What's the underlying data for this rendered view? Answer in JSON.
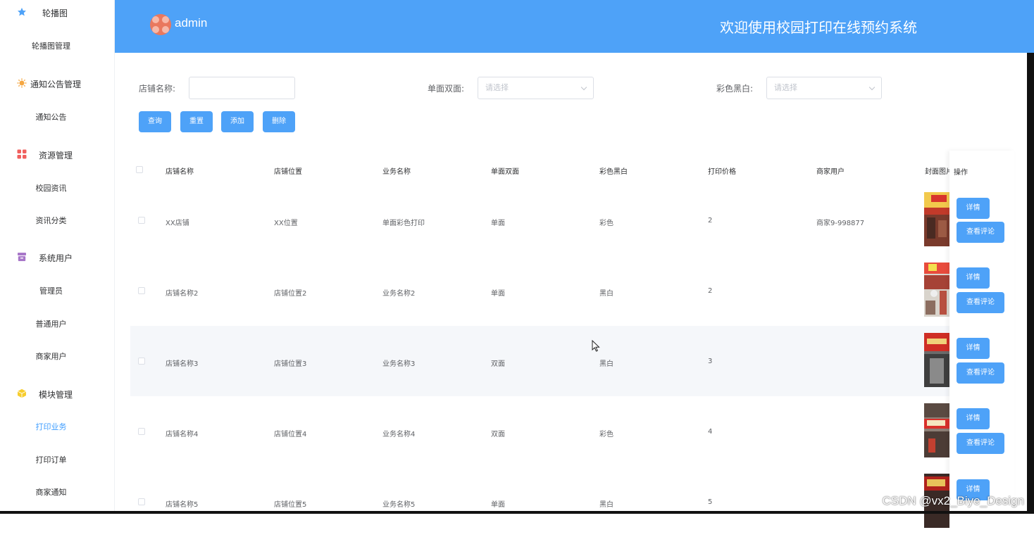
{
  "header": {
    "admin_name": "admin",
    "welcome": "欢迎使用校园打印在线预约系统"
  },
  "sidebar": {
    "groups": [
      {
        "label": "轮播图",
        "icon": "star-icon",
        "items": [
          "轮播图管理"
        ]
      },
      {
        "label": "通知公告管理",
        "icon": "sun-icon",
        "items": [
          "通知公告"
        ]
      },
      {
        "label": "资源管理",
        "icon": "grid-icon",
        "items": [
          "校园资讯",
          "资讯分类"
        ]
      },
      {
        "label": "系统用户",
        "icon": "archive-icon",
        "items": [
          "管理员",
          "普通用户",
          "商家用户"
        ]
      },
      {
        "label": "模块管理",
        "icon": "cube-icon",
        "items": [
          "打印业务",
          "打印订单",
          "商家通知"
        ]
      }
    ],
    "active_item": "打印业务"
  },
  "filters": {
    "shop_name_label": "店铺名称:",
    "shop_name_value": "",
    "sides_label": "单面双面:",
    "sides_placeholder": "请选择",
    "color_label": "彩色黑白:",
    "color_placeholder": "请选择"
  },
  "actions": {
    "query": "查询",
    "reset": "重置",
    "add": "添加",
    "delete": "删除"
  },
  "table": {
    "headers": [
      "店铺名称",
      "店铺位置",
      "业务名称",
      "单面双面",
      "彩色黑白",
      "打印价格",
      "商家用户",
      "封面图片",
      "操作"
    ],
    "rows": [
      {
        "shop": "XX店铺",
        "location": "XX位置",
        "service": "单面彩色打印",
        "sides": "单面",
        "color": "彩色",
        "price": "2",
        "merchant": "商家9-998877"
      },
      {
        "shop": "店铺名称2",
        "location": "店铺位置2",
        "service": "业务名称2",
        "sides": "单面",
        "color": "黑白",
        "price": "2",
        "merchant": ""
      },
      {
        "shop": "店铺名称3",
        "location": "店铺位置3",
        "service": "业务名称3",
        "sides": "双面",
        "color": "黑白",
        "price": "3",
        "merchant": ""
      },
      {
        "shop": "店铺名称4",
        "location": "店铺位置4",
        "service": "业务名称4",
        "sides": "双面",
        "color": "彩色",
        "price": "4",
        "merchant": ""
      },
      {
        "shop": "店铺名称5",
        "location": "店铺位置5",
        "service": "业务名称5",
        "sides": "单面",
        "color": "黑白",
        "price": "5",
        "merchant": ""
      }
    ],
    "op_detail": "详情",
    "op_comments": "查看评论"
  },
  "watermark": "CSDN @vx2_Biye_Design",
  "colors": {
    "primary": "#4ea2f8",
    "header_bg": "#4ea2f8",
    "active_text": "#409eff"
  }
}
